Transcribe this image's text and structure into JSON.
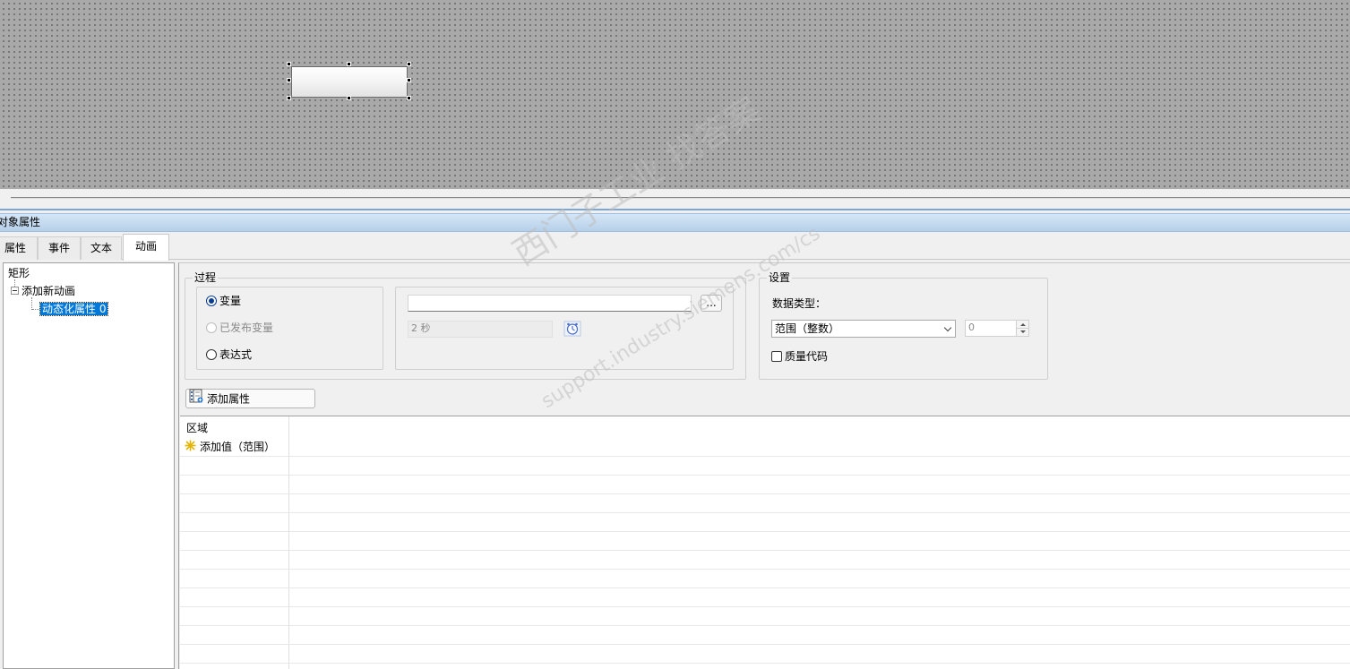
{
  "panel": {
    "title": "对象属性"
  },
  "tabs": [
    {
      "label": "属性"
    },
    {
      "label": "事件"
    },
    {
      "label": "文本"
    },
    {
      "label": "动画"
    }
  ],
  "tree": {
    "root": "矩形",
    "child": "添加新动画",
    "leaf": "动态化属性 0"
  },
  "process": {
    "legend": "过程",
    "options": [
      {
        "label": "变量",
        "selected": true,
        "enabled": true
      },
      {
        "label": "已发布变量",
        "selected": false,
        "enabled": false
      },
      {
        "label": "表达式",
        "selected": false,
        "enabled": true
      }
    ],
    "variable_value": "",
    "browse_label": "...",
    "cycle_value": "2 秒"
  },
  "settings": {
    "legend": "设置",
    "data_type_label": "数据类型：",
    "data_type_value": "范围（整数）",
    "spin_value": "0",
    "quality_code_label": "质量代码",
    "quality_code_checked": false
  },
  "add_property_button": "添加属性",
  "grid": {
    "header": "区域",
    "add_row": "添加值（范围）"
  },
  "watermark": {
    "line1": "西门子工业 找答案",
    "line2": "support.industry.siemens.com/cs"
  },
  "colors": {
    "canvas": "#a9a9a9",
    "title_bar": "#c4dbf1",
    "selection": "#0078d7"
  }
}
